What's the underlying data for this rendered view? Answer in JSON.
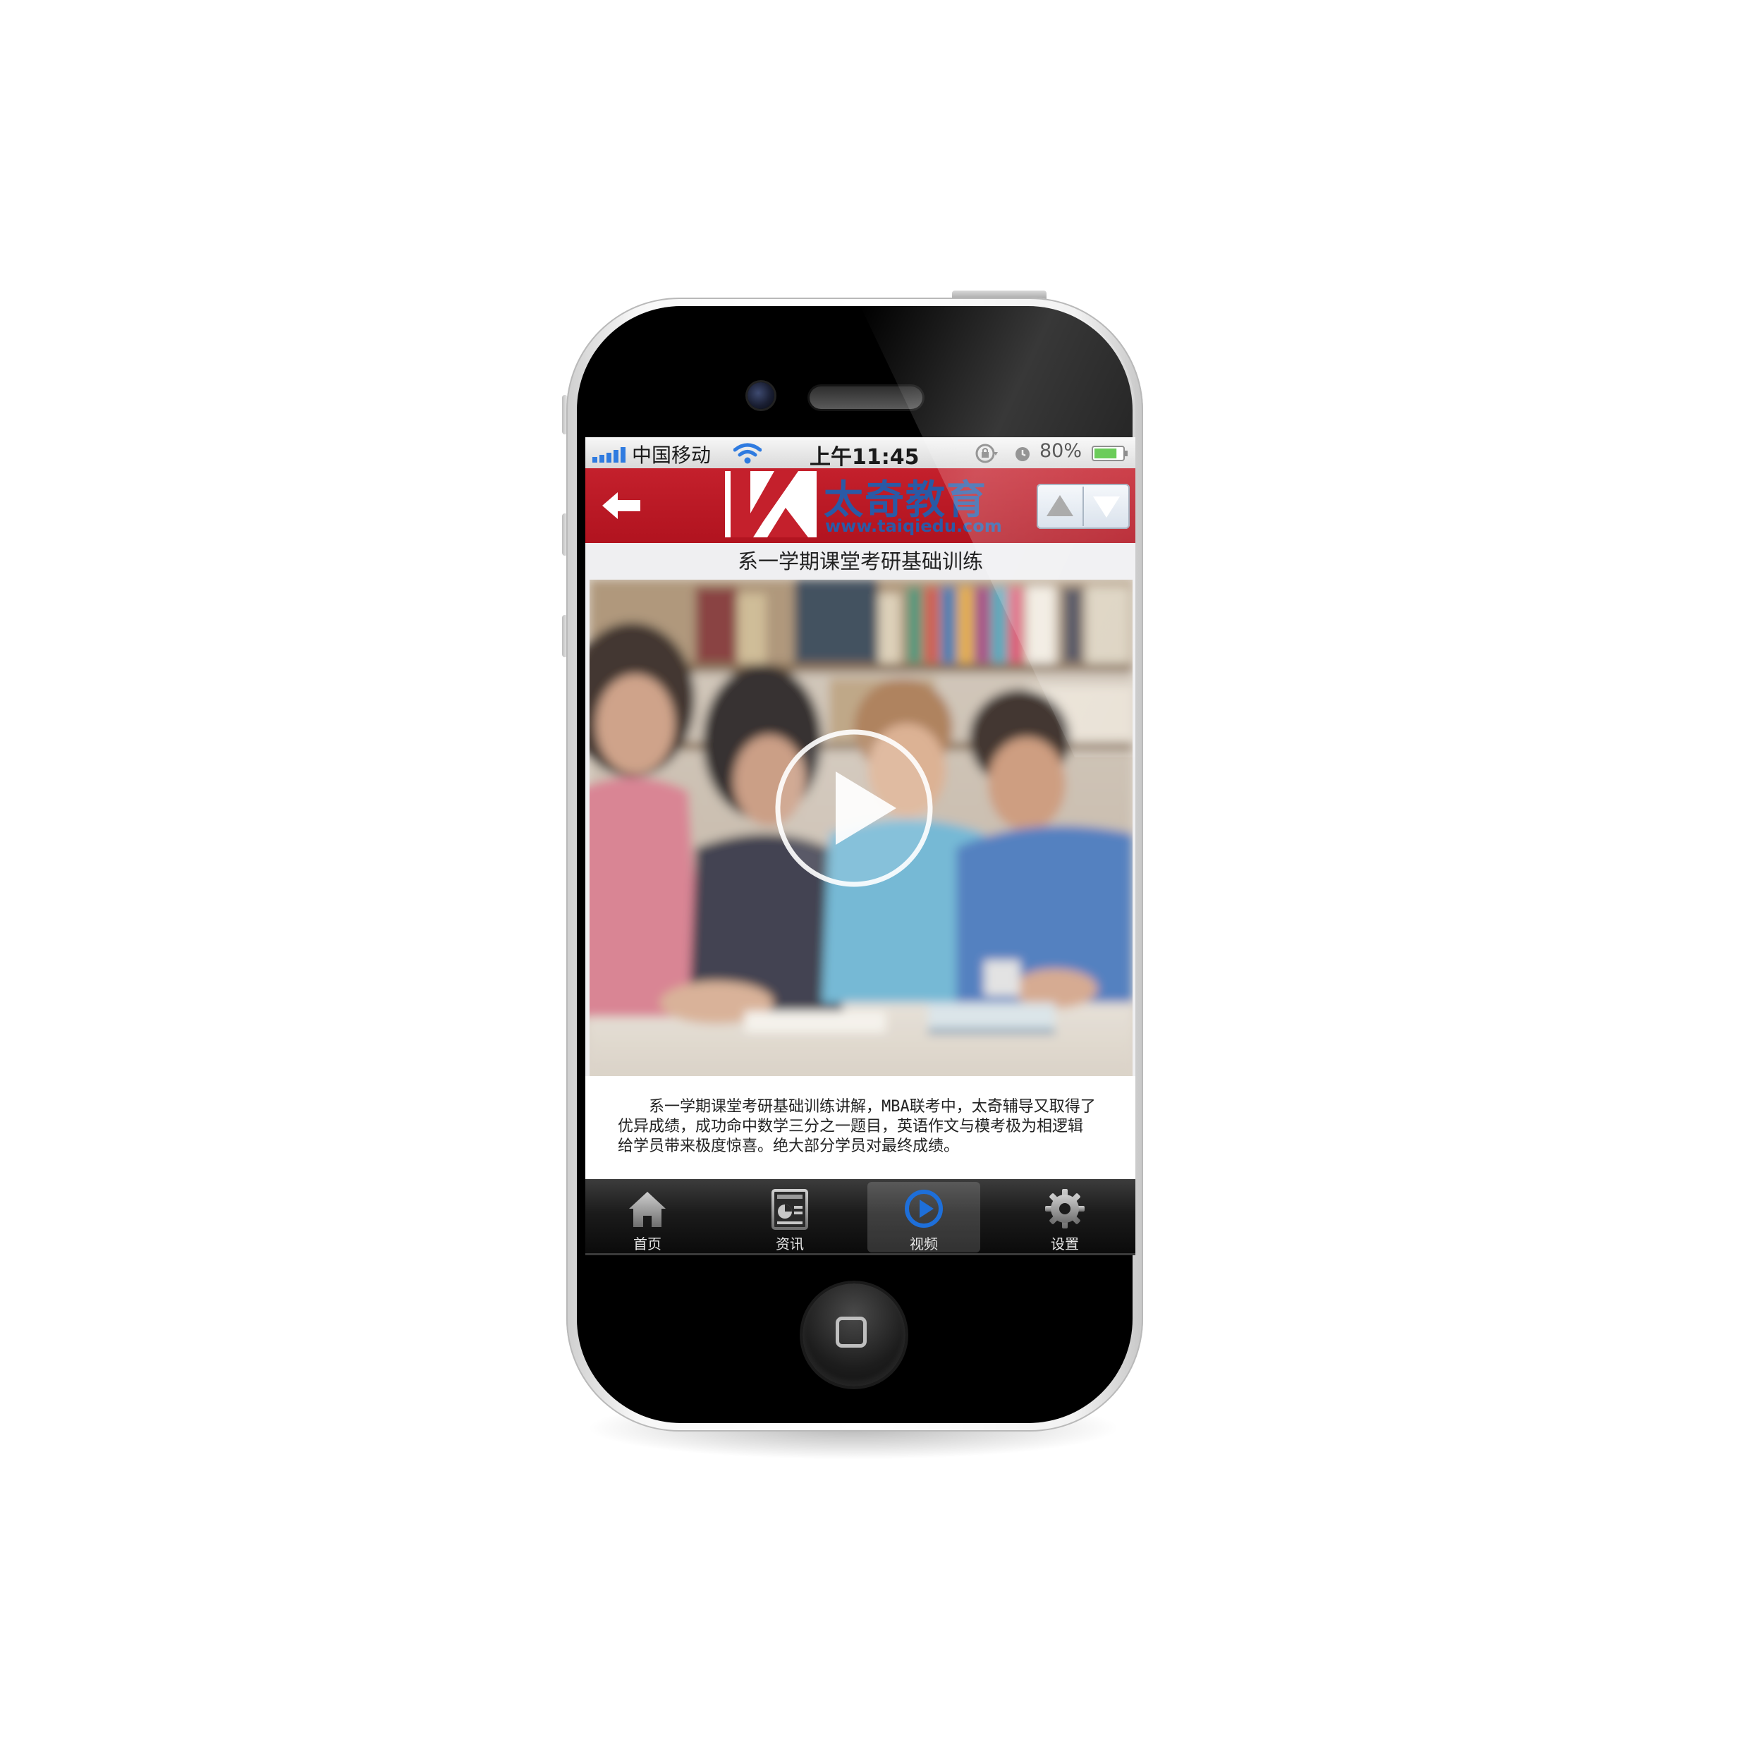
{
  "status_bar": {
    "carrier": "中国移动",
    "time": "上午11:45",
    "battery_percent": "80%",
    "battery_level": 0.8,
    "icons": [
      "signal-bars-icon",
      "wifi-icon",
      "rotation-lock-icon",
      "alarm-icon",
      "battery-icon"
    ]
  },
  "header": {
    "back_icon": "back-arrow-icon",
    "logo": {
      "name": "太奇教育",
      "url": "www.taiqiedu.com"
    },
    "nav_buttons": [
      "up-arrow-icon",
      "down-arrow-icon"
    ],
    "accent_color": "#c4202c",
    "logo_text_color": "#2a5aa6"
  },
  "page": {
    "title": "系一学期课堂考研基础训练",
    "video": {
      "play_icon": "play-icon"
    },
    "description": "系一学期课堂考研基础训练讲解，MBA联考中，太奇辅导又取得了优异成绩，成功命中数学三分之一题目，英语作文与模考极为相逻辑给学员带来极度惊喜。绝大部分学员对最终成绩。"
  },
  "tabs": [
    {
      "label": "首页",
      "icon": "home-icon",
      "active": false
    },
    {
      "label": "资讯",
      "icon": "news-icon",
      "active": false
    },
    {
      "label": "视频",
      "icon": "video-play-icon",
      "active": true
    },
    {
      "label": "设置",
      "icon": "gear-icon",
      "active": false
    }
  ],
  "active_tab_color": "#1e6fd9"
}
